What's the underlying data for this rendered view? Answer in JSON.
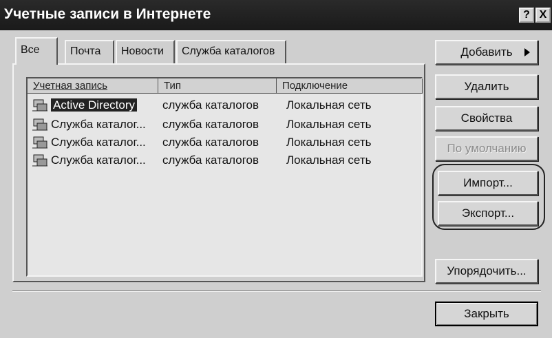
{
  "window": {
    "title": "Учетные записи в Интернете"
  },
  "titlebar": {
    "help_label": "?",
    "close_label": "X"
  },
  "tabs": [
    {
      "label": "Все"
    },
    {
      "label": "Почта"
    },
    {
      "label": "Новости"
    },
    {
      "label": "Служба каталогов"
    }
  ],
  "list": {
    "columns": [
      "Учетная запись",
      "Тип",
      "Подключение"
    ],
    "rows": [
      {
        "account": "Active Directory",
        "type": "служба каталогов",
        "connection": "Локальная сеть",
        "selected": true
      },
      {
        "account": "Служба каталог...",
        "type": "служба каталогов",
        "connection": "Локальная сеть",
        "selected": false
      },
      {
        "account": "Служба каталог...",
        "type": "служба каталогов",
        "connection": "Локальная сеть",
        "selected": false
      },
      {
        "account": "Служба каталог...",
        "type": "служба каталогов",
        "connection": "Локальная сеть",
        "selected": false
      }
    ]
  },
  "buttons": {
    "add": "Добавить",
    "remove": "Удалить",
    "properties": "Свойства",
    "set_default": "По умолчанию",
    "import": "Импорт...",
    "export": "Экспорт...",
    "order": "Упорядочить...",
    "close": "Закрыть"
  },
  "icons": {
    "row_icon": "directory-service-icon",
    "add_arrow": "submenu-arrow-icon"
  }
}
